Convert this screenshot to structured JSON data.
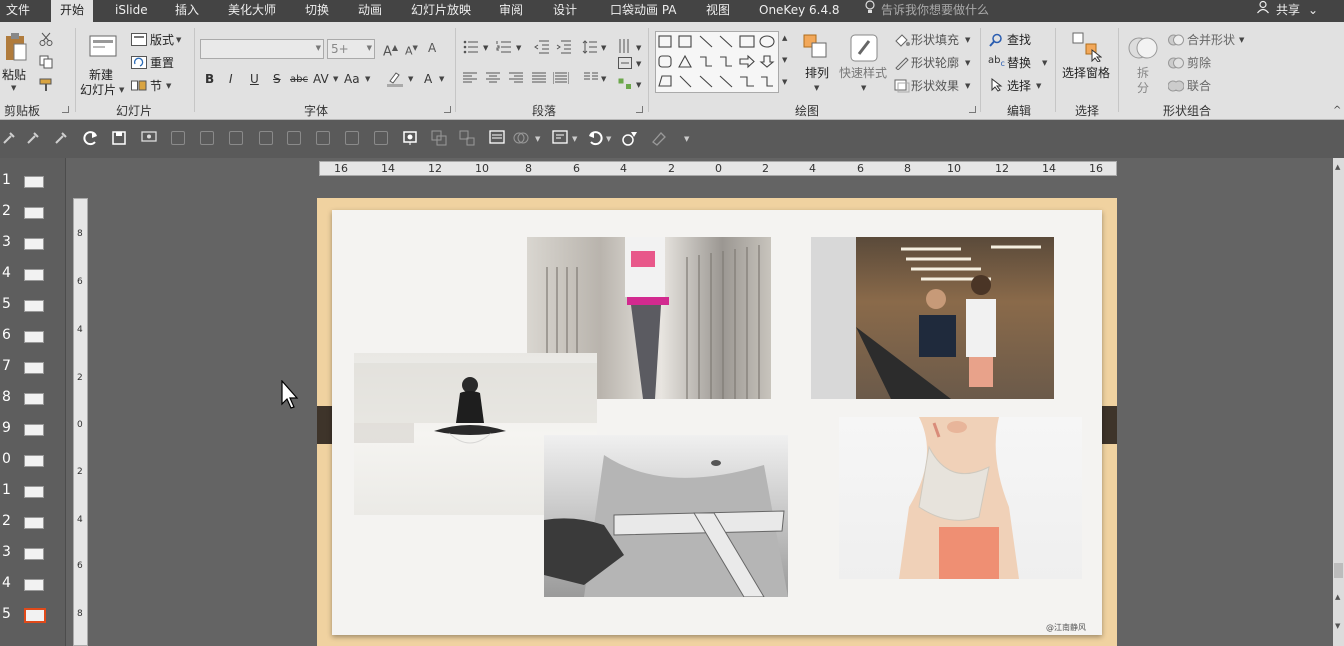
{
  "menu": {
    "tabs": [
      "文件",
      "开始",
      "iSlide",
      "插入",
      "美化大师",
      "切换",
      "动画",
      "幻灯片放映",
      "审阅",
      "设计",
      "口袋动画 PA",
      "视图",
      "OneKey 6.4.8"
    ],
    "active_tab": "开始",
    "tell_me": "告诉我你想要做什么",
    "share": "共享"
  },
  "ribbon": {
    "clipboard": {
      "paste": "粘贴",
      "group": "剪贴板"
    },
    "slides": {
      "new_slide_1": "新建",
      "new_slide_2": "幻灯片",
      "layout": "版式",
      "reset": "重置",
      "section": "节",
      "group": "幻灯片"
    },
    "font": {
      "font_name": "",
      "font_size": "5+",
      "bold": "B",
      "italic": "I",
      "underline": "U",
      "strike": "S",
      "abc": "abc",
      "group": "字体"
    },
    "paragraph": {
      "group": "段落"
    },
    "drawing": {
      "arrange": "排列",
      "quick_styles": "快速样式",
      "shape_fill": "形状填充",
      "shape_outline": "形状轮廓",
      "shape_effects": "形状效果",
      "group": "绘图"
    },
    "editing": {
      "find": "查找",
      "replace": "替换",
      "select": "选择",
      "group": "编辑"
    },
    "select": {
      "selection_pane": "选择窗格",
      "group": "选择"
    },
    "shape_combine": {
      "split_1": "拆",
      "split_2": "分",
      "merge_shapes": "合并形状",
      "subtract": "剪除",
      "union": "联合",
      "group": "形状组合"
    }
  },
  "slides_panel": {
    "numbers": [
      "1",
      "2",
      "3",
      "4",
      "5",
      "6",
      "7",
      "8",
      "9",
      "0",
      "1",
      "2",
      "3",
      "4",
      "5"
    ]
  },
  "rulers": {
    "h_labels": [
      "16",
      "14",
      "12",
      "10",
      "8",
      "6",
      "4",
      "2",
      "0",
      "2",
      "4",
      "6",
      "8",
      "10",
      "12",
      "14",
      "16"
    ],
    "v_labels": [
      "8",
      "6",
      "4",
      "2",
      "0",
      "2",
      "4",
      "6",
      "8"
    ]
  },
  "slide": {
    "watermark": "@江南静风",
    "photos": [
      "yoga-meditation",
      "running-bridge",
      "gym-trainer",
      "waist-measuring-tape",
      "towel-drinking"
    ]
  },
  "colors": {
    "menubar": "#444444",
    "ribbon": "#e1e1e1",
    "selected_thumb_border": "#e04a1a",
    "band": "#3e342a",
    "frame": "#f0d2a0"
  }
}
